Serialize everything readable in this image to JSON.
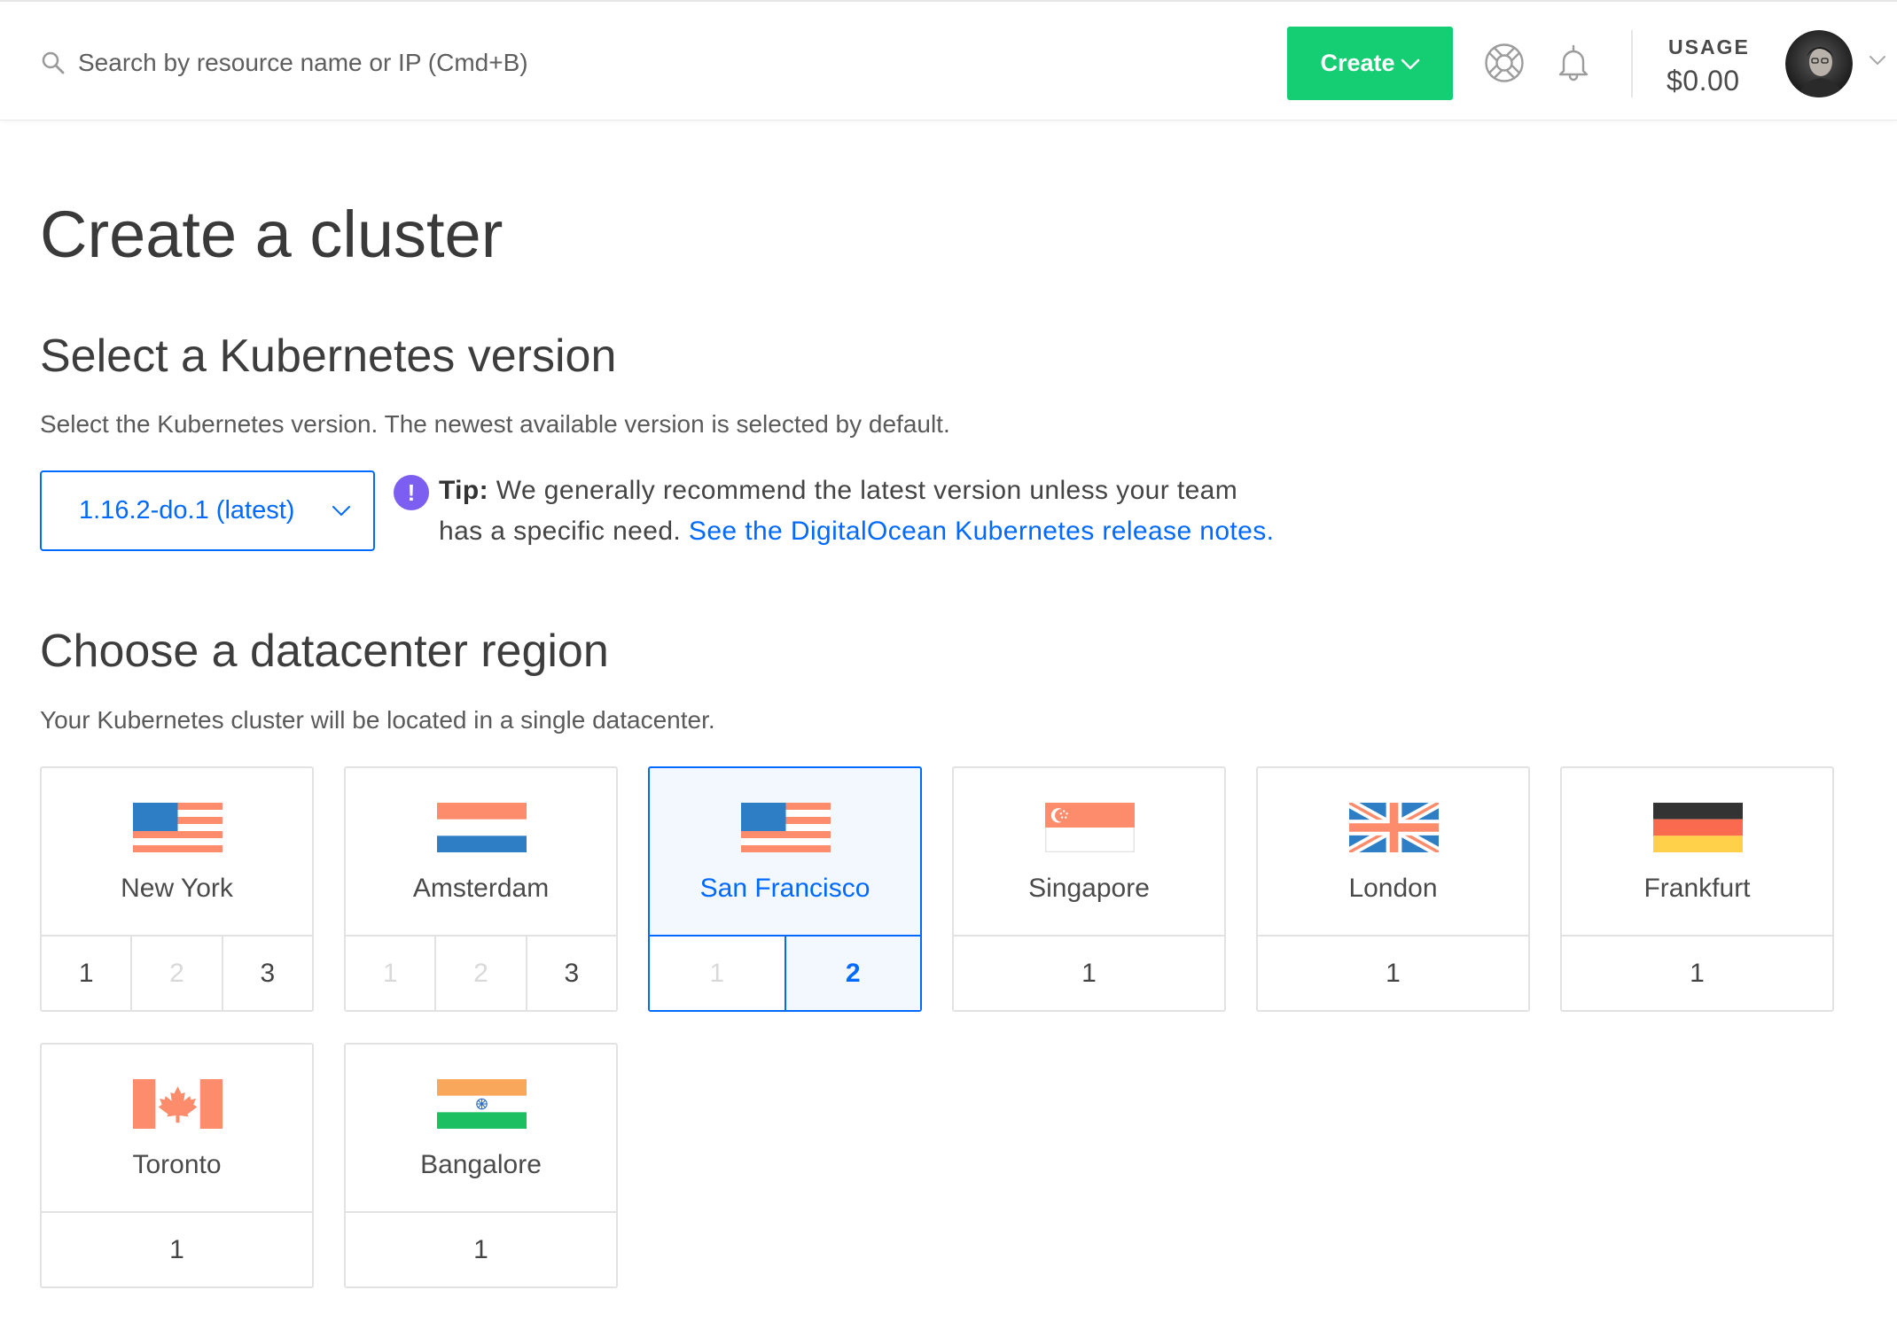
{
  "header": {
    "search": {
      "placeholder": "Search by resource name or IP (Cmd+B)",
      "icon": "search-icon"
    },
    "create_button": {
      "label": "Create",
      "icon": "chevron-down-icon"
    },
    "help_icon": "lifebuoy-icon",
    "notifications_icon": "bell-icon",
    "usage": {
      "label": "USAGE",
      "value": "$0.00"
    },
    "account_menu_icon": "chevron-down-icon"
  },
  "colors": {
    "primary": "#0069ff",
    "create_button": "#15cd72",
    "tip_icon": "#7c5ff0",
    "selected_background": "#f3f8ff",
    "flag_salmon": "#fc8c6b",
    "flag_blue": "#2d7ec4"
  },
  "page": {
    "title": "Create a cluster"
  },
  "version_section": {
    "heading": "Select a Kubernetes version",
    "description": "Select the Kubernetes version. The newest available version is selected by default.",
    "selected_version": "1.16.2-do.1 (latest)",
    "dropdown_icon": "chevron-down-icon",
    "tip": {
      "icon": "exclamation-icon",
      "label": "Tip:",
      "line1": "We generally recommend the latest version unless your team",
      "line2": "has a specific need.",
      "link": "See the DigitalOcean Kubernetes release notes."
    }
  },
  "region_section": {
    "heading": "Choose a datacenter region",
    "description": "Your Kubernetes cluster will be located in a single datacenter.",
    "regions": [
      {
        "name": "New York",
        "flag": "us-flag-icon",
        "state": "default",
        "datacenters": [
          {
            "label": "1",
            "state": "available"
          },
          {
            "label": "2",
            "state": "unavailable"
          },
          {
            "label": "3",
            "state": "available"
          }
        ]
      },
      {
        "name": "Amsterdam",
        "flag": "nl-flag-icon",
        "state": "default",
        "datacenters": [
          {
            "label": "1",
            "state": "unavailable"
          },
          {
            "label": "2",
            "state": "unavailable"
          },
          {
            "label": "3",
            "state": "available"
          }
        ]
      },
      {
        "name": "San Francisco",
        "flag": "us-flag-icon",
        "state": "selected",
        "datacenters": [
          {
            "label": "1",
            "state": "unavailable"
          },
          {
            "label": "2",
            "state": "selected"
          }
        ]
      },
      {
        "name": "Singapore",
        "flag": "sg-flag-icon",
        "state": "default",
        "datacenters": [
          {
            "label": "1",
            "state": "available"
          }
        ]
      },
      {
        "name": "London",
        "flag": "uk-flag-icon",
        "state": "default",
        "datacenters": [
          {
            "label": "1",
            "state": "available"
          }
        ]
      },
      {
        "name": "Frankfurt",
        "flag": "de-flag-icon",
        "state": "default",
        "datacenters": [
          {
            "label": "1",
            "state": "available"
          }
        ]
      },
      {
        "name": "Toronto",
        "flag": "ca-flag-icon",
        "state": "default",
        "datacenters": [
          {
            "label": "1",
            "state": "available"
          }
        ]
      },
      {
        "name": "Bangalore",
        "flag": "in-flag-icon",
        "state": "default",
        "datacenters": [
          {
            "label": "1",
            "state": "available"
          }
        ]
      }
    ]
  }
}
